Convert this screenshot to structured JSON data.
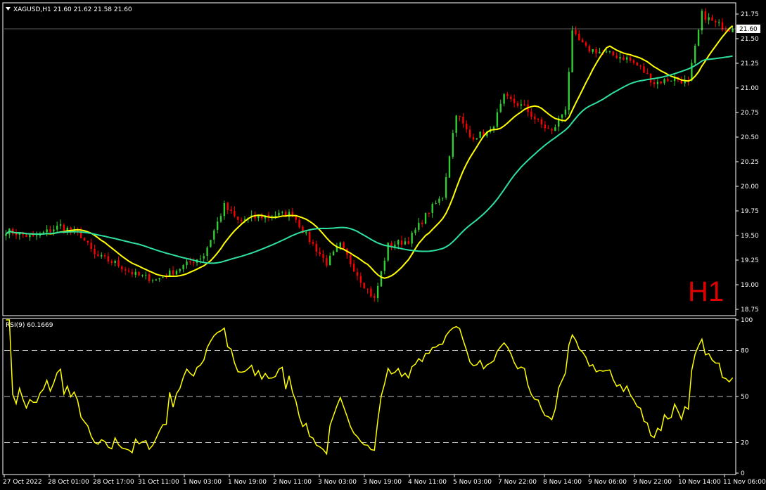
{
  "header": {
    "symbol": "XAGUSD,H1",
    "ohlc": "21.60 21.62 21.58 21.60"
  },
  "watermark": "H1",
  "colors": {
    "bull": "#32cd32",
    "bear": "#ff0000",
    "ma_fast": "#ffff00",
    "ma_slow": "#2ee0a0",
    "rsi": "#ffff00",
    "grid": "#ffffff",
    "current_price": "#ffffff"
  },
  "chart_data": [
    {
      "type": "candlestick",
      "title": "",
      "ylim": [
        18.7,
        21.85
      ],
      "y_ticks": [
        18.75,
        19.0,
        19.25,
        19.5,
        19.75,
        20.0,
        20.25,
        20.5,
        20.75,
        21.0,
        21.25,
        21.5,
        21.75
      ],
      "current_price": 21.6,
      "x_tick_labels": [
        "27 Oct 2022",
        "28 Oct 01:00",
        "28 Oct 17:00",
        "31 Oct 11:00",
        "1 Nov 03:00",
        "1 Nov 19:00",
        "2 Nov 11:00",
        "3 Nov 03:00",
        "3 Nov 19:00",
        "4 Nov 11:00",
        "5 Nov 03:00",
        "7 Nov 22:00",
        "8 Nov 14:00",
        "9 Nov 06:00",
        "9 Nov 22:00",
        "10 Nov 14:00",
        "11 Nov 06:00"
      ],
      "close_keypoints": [
        [
          0,
          19.55
        ],
        [
          8,
          19.48
        ],
        [
          16,
          19.6
        ],
        [
          22,
          19.5
        ],
        [
          26,
          19.3
        ],
        [
          32,
          19.22
        ],
        [
          38,
          19.1
        ],
        [
          44,
          19.05
        ],
        [
          50,
          19.15
        ],
        [
          58,
          19.3
        ],
        [
          64,
          19.8
        ],
        [
          68,
          19.65
        ],
        [
          76,
          19.7
        ],
        [
          84,
          19.72
        ],
        [
          88,
          19.5
        ],
        [
          94,
          19.22
        ],
        [
          98,
          19.4
        ],
        [
          104,
          19.05
        ],
        [
          108,
          18.85
        ],
        [
          112,
          19.4
        ],
        [
          118,
          19.45
        ],
        [
          124,
          19.75
        ],
        [
          128,
          19.9
        ],
        [
          132,
          20.75
        ],
        [
          136,
          20.5
        ],
        [
          142,
          20.55
        ],
        [
          146,
          20.9
        ],
        [
          152,
          20.8
        ],
        [
          156,
          20.65
        ],
        [
          160,
          20.55
        ],
        [
          164,
          20.8
        ],
        [
          166,
          21.55
        ],
        [
          170,
          21.4
        ],
        [
          176,
          21.35
        ],
        [
          182,
          21.3
        ],
        [
          186,
          21.2
        ],
        [
          190,
          21.05
        ],
        [
          196,
          21.1
        ],
        [
          200,
          21.05
        ],
        [
          204,
          21.75
        ],
        [
          208,
          21.65
        ],
        [
          212,
          21.6
        ]
      ],
      "moving_averages": [
        {
          "period": 12,
          "color_key": "ma_fast"
        },
        {
          "period": 40,
          "color_key": "ma_slow"
        }
      ]
    },
    {
      "type": "line",
      "title": "RSI(9) 60.1669",
      "ylim": [
        0,
        100
      ],
      "y_ticks": [
        0,
        20,
        50,
        80,
        100
      ],
      "levels": [
        20,
        50,
        80
      ],
      "period": 9
    }
  ]
}
